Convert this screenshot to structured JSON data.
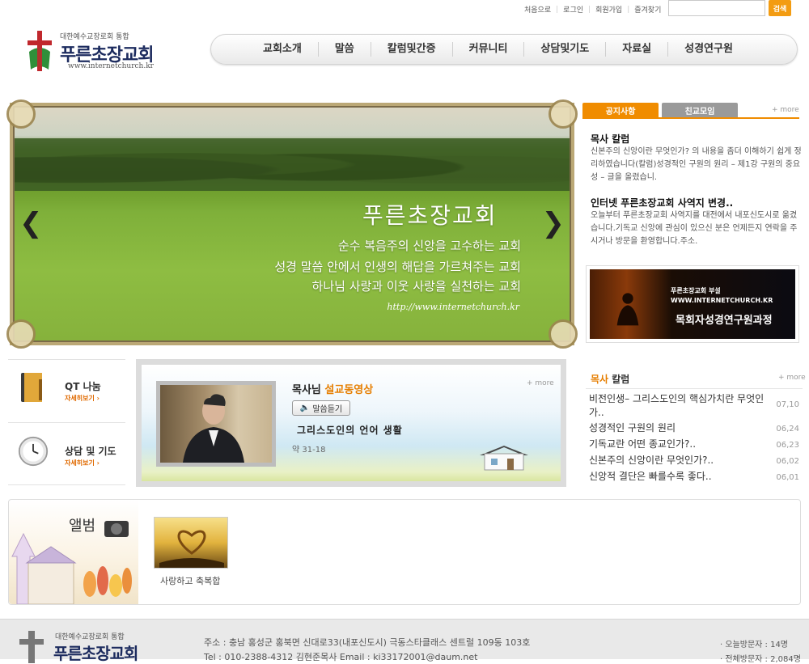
{
  "util_links": [
    "처음으로",
    "로그인",
    "회원가입",
    "즐겨찾기"
  ],
  "search": {
    "placeholder": "",
    "button": "검색"
  },
  "logo": {
    "sub": "대한예수교장로회 통합",
    "name": "푸른초장교회",
    "url": "www.internetchurch.kr"
  },
  "nav": [
    "교회소개",
    "말씀",
    "칼럼및간증",
    "커뮤니티",
    "상담및기도",
    "자료실",
    "성경연구원"
  ],
  "hero": {
    "title": "푸른초장교회",
    "lines": [
      "순수 복음주의 신앙을 고수하는 교회",
      "성경 말씀 안에서 인생의 해답을 가르쳐주는 교회",
      "하나님 사랑과 이웃 사랑을 실천하는 교회"
    ],
    "url": "http://www.internetchurch.kr",
    "prev": "❮",
    "next": "❯"
  },
  "notice": {
    "tabs": [
      "공지사항",
      "친교모임"
    ],
    "more": "+ more",
    "items": [
      {
        "title": "목사 칼럼",
        "body": "신본주의 신앙이란 무엇인가? 의 내용을 좀더 이해하기 쉽게 정리하였습니다(칼럼)성경적인 구원의 원리 – 제1강 구원의 중요성 – 글을 올렸습니."
      },
      {
        "title": "인터넷 푸른초장교회 사역지 변경..",
        "body": "오늘부터 푸른초장교회 사역지를 대전에서 내포신도시로 옮겼습니다.기독교 신앙에 관심이 있으신 분은 언제든지 연락을 주시거나 방문을 환영합니다.주소."
      }
    ]
  },
  "banner": {
    "sub1": "푸른초장교회 부설",
    "sub2": "WWW.INTERNETCHURCH.KR",
    "title": "목회자성경연구원과정"
  },
  "quick": [
    {
      "title": "QT 나눔",
      "more": "자세히보기 ›"
    },
    {
      "title": "상담 및 기도",
      "more": "자세히보기 ›"
    }
  ],
  "sermon": {
    "label_prefix": "목사님 ",
    "label_highlight": "설교동영상",
    "listen": "말씀듣기",
    "title": "그리스도인의 언어 생활",
    "verse": "약 31-18",
    "more": "+ more"
  },
  "column": {
    "title_prefix": "목사",
    "title_rest": " 칼럼",
    "more": "+ more",
    "items": [
      {
        "title": "비전인생– 그리스도인의 핵심가치란 무엇인가..",
        "date": "07,10"
      },
      {
        "title": "성경적인 구원의 원리",
        "date": "06,24"
      },
      {
        "title": "기독교란 어떤 종교인가?..",
        "date": "06,23"
      },
      {
        "title": "신본주의 신앙이란 무엇인가?..",
        "date": "06,02"
      },
      {
        "title": "신앙적 결단은 빠를수록 좋다..",
        "date": "06,01"
      }
    ]
  },
  "album": {
    "title": "앨범",
    "caption": "사랑하고 축복합"
  },
  "footer": {
    "sub": "대한예수교장로회 통합",
    "name": "푸른초장교회",
    "address": "주소 : 충남 홍성군 홍북면 신대로33(내포신도시) 극동스타클래스 센트럴 109동 103호",
    "tel": "Tel : 010-2388-4312 김현준목사      Email : ki33172001@daum.net",
    "today": "· 오늘방문자 : 14명",
    "total": "· 전체방문자 : 2,084명"
  },
  "colors": {
    "accent": "#f08c00",
    "brand": "#1c2b5e",
    "grass": "#86b23c"
  }
}
